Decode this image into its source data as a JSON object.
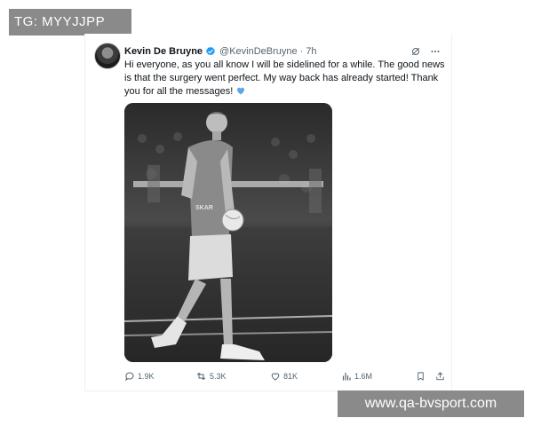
{
  "overlay": {
    "top_left_text": "TG: MYYJJPP",
    "bottom_right_text": "www.qa-bvsport.com"
  },
  "tweet": {
    "author_name": "Kevin De Bruyne",
    "handle": "@KevinDeBruyne",
    "separator": "·",
    "time": "7h",
    "verified": true,
    "verified_color": "#1d9bf0",
    "text": "Hi everyone, as you all know I will be sidelined for a while. The good news is that the surgery went perfect. My way back has already started! Thank you for all the messages!",
    "emoji": "blue-heart",
    "emoji_color": "#5aa8ea",
    "header_icons": [
      "grok-icon",
      "more-icon"
    ],
    "actions": {
      "replies": "1.9K",
      "reposts": "5.3K",
      "likes": "81K",
      "views": "1.6M"
    }
  }
}
